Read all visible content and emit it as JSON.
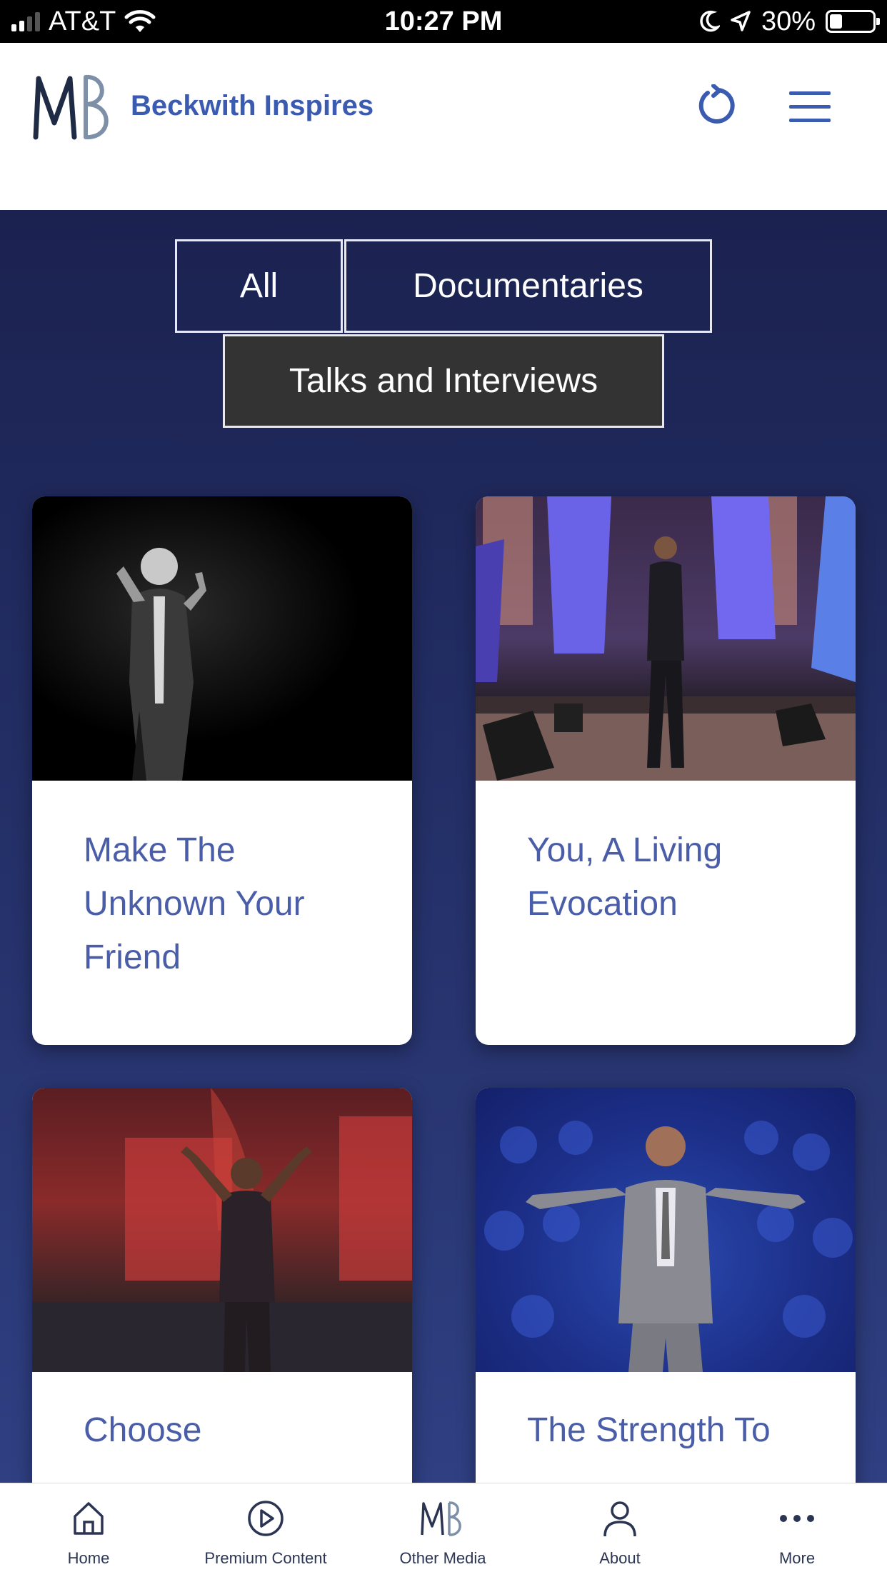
{
  "status_bar": {
    "carrier": "AT&T",
    "time": "10:27 PM",
    "battery": "30%",
    "battery_level": 0.3
  },
  "header": {
    "logo_mark": "MB",
    "title": "Beckwith Inspires",
    "brand_color": "#3b5bb0"
  },
  "filters": [
    {
      "label": "All",
      "active": false
    },
    {
      "label": "Documentaries",
      "active": false
    },
    {
      "label": "Talks and Interviews",
      "active": true
    }
  ],
  "cards": [
    {
      "title": "Make The Unknown Your Friend",
      "image": "speaker-on-dark-stage"
    },
    {
      "title": "You, A Living Evocation",
      "image": "speaker-on-blue-lit-stage"
    },
    {
      "title": "Choose",
      "image": "speaker-with-red-flowers"
    },
    {
      "title": "The Strength To",
      "image": "speaker-with-choir"
    }
  ],
  "tab_bar": {
    "tabs": [
      {
        "label": "Home",
        "icon": "home-icon"
      },
      {
        "label": "Premium Content",
        "icon": "play-icon"
      },
      {
        "label": "Other Media",
        "icon": "mb-logo-icon"
      },
      {
        "label": "About",
        "icon": "person-icon"
      },
      {
        "label": "More",
        "icon": "more-dots-icon"
      }
    ]
  }
}
